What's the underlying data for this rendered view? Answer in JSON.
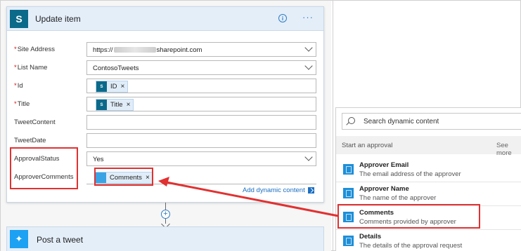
{
  "update_card": {
    "title": "Update item",
    "info_glyph": "i",
    "more_glyph": "···",
    "icon": "sharepoint-icon",
    "fields": {
      "site_address": {
        "label": "Site Address",
        "value_prefix": "https://",
        "value_suffix": "sharepoint.com",
        "required": true
      },
      "list_name": {
        "label": "List Name",
        "value": "ContosoTweets",
        "required": true
      },
      "id": {
        "label": "Id",
        "token": "ID",
        "required": true
      },
      "title": {
        "label": "Title",
        "token": "Title",
        "required": true
      },
      "tweet_content": {
        "label": "TweetContent",
        "value": ""
      },
      "tweet_date": {
        "label": "TweetDate",
        "value": ""
      },
      "approval_status": {
        "label": "ApprovalStatus",
        "value": "Yes"
      },
      "approver_comments": {
        "label": "ApproverComments",
        "token": "Comments"
      }
    },
    "required_mark": "*",
    "token_remove": "×",
    "add_dynamic_content": "Add dynamic content"
  },
  "plus_glyph": "+",
  "tweet_card": {
    "title": "Post a tweet",
    "icon": "twitter-icon"
  },
  "dynamic_panel": {
    "search_placeholder": "Search dynamic content",
    "section_title": "Start an approval",
    "see_more": "See more",
    "items": [
      {
        "name": "Approver Email",
        "desc": "The email address of the approver",
        "icon": "approval-icon"
      },
      {
        "name": "Approver Name",
        "desc": "The name of the approver",
        "icon": "approval-icon"
      },
      {
        "name": "Comments",
        "desc": "Comments provided by approver",
        "icon": "approval-icon"
      },
      {
        "name": "Details",
        "desc": "The details of the approval request",
        "icon": "approval-icon"
      }
    ]
  },
  "colors": {
    "highlight": "#e13131",
    "accent": "#1c6fc2",
    "header_bg": "#e4eef9"
  }
}
